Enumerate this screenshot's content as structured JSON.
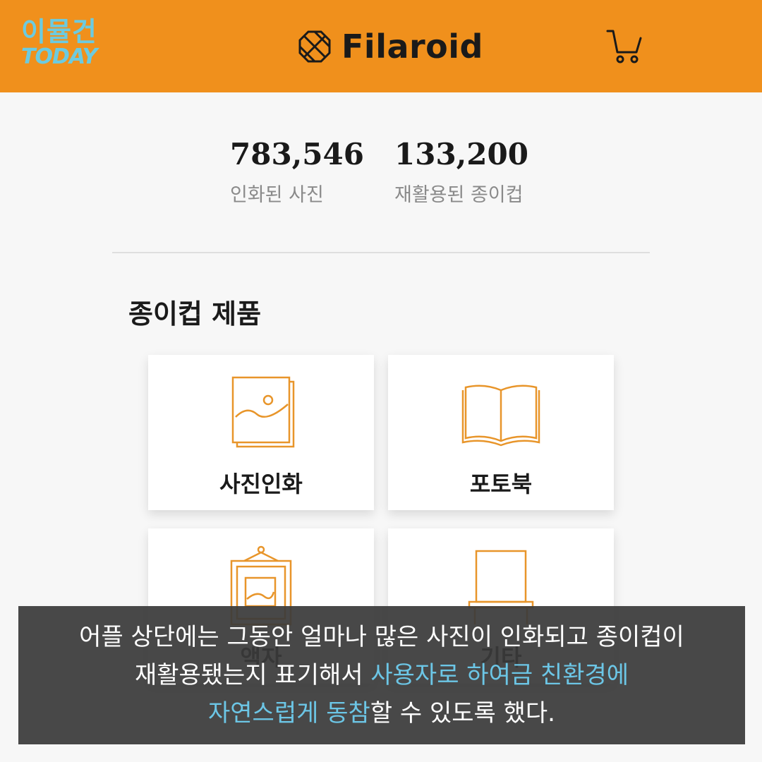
{
  "watermark": {
    "top": "이뮬건",
    "bottom": "TODAY"
  },
  "header": {
    "logo_text": "Filaroid",
    "cart_icon": "cart-icon"
  },
  "stats": [
    {
      "value": "783,546",
      "label": "인화된 사진"
    },
    {
      "value": "133,200",
      "label": "재활용된 종이컵"
    }
  ],
  "section": {
    "title": "종이컵 제품"
  },
  "products": [
    {
      "label": "사진인화",
      "icon": "photo-print-icon"
    },
    {
      "label": "포토북",
      "icon": "photobook-icon"
    },
    {
      "label": "액자",
      "icon": "frame-icon"
    },
    {
      "label": "기타",
      "icon": "other-icon"
    }
  ],
  "caption": {
    "line1": "어플 상단에는 그동안 얼마나 많은 사진이 인화되고 종이컵이",
    "line2a": "재활용됐는지 표기해서 ",
    "line2b": "사용자로 하여금 친환경에",
    "line3a": "자연스럽게 동참",
    "line3b": "할 수 있도록 했다."
  },
  "colors": {
    "header": "#f0901c",
    "accent_icon": "#e8952a",
    "highlight": "#6cc6e6"
  }
}
